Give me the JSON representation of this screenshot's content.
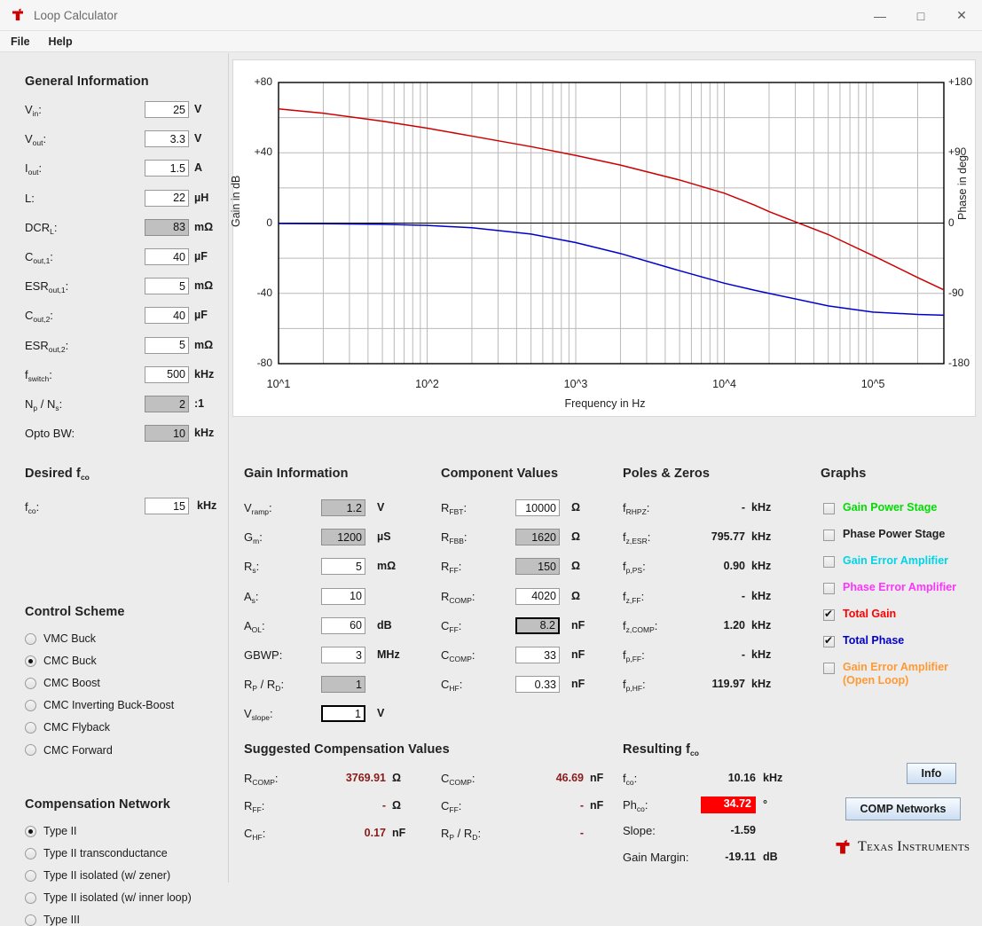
{
  "window": {
    "title": "Loop Calculator",
    "minimize": "—",
    "maximize": "□",
    "close": "✕"
  },
  "menu": {
    "file": "File",
    "help": "Help"
  },
  "general": {
    "title": "General Information",
    "rows": [
      {
        "label": "V",
        "sub": "in",
        "value": "25",
        "unit": "V",
        "disabled": false
      },
      {
        "label": "V",
        "sub": "out",
        "value": "3.3",
        "unit": "V",
        "disabled": false
      },
      {
        "label": "I",
        "sub": "out",
        "value": "1.5",
        "unit": "A",
        "disabled": false
      },
      {
        "label": "L",
        "sub": "",
        "value": "22",
        "unit": "µH",
        "disabled": false
      },
      {
        "label": "DCR",
        "sub": "L",
        "value": "83",
        "unit": "mΩ",
        "disabled": true
      },
      {
        "label": "C",
        "sub": "out,1",
        "value": "40",
        "unit": "µF",
        "disabled": false
      },
      {
        "label": "ESR",
        "sub": "out,1",
        "value": "5",
        "unit": "mΩ",
        "disabled": false
      },
      {
        "label": "C",
        "sub": "out,2",
        "value": "40",
        "unit": "µF",
        "disabled": false
      },
      {
        "label": "ESR",
        "sub": "out,2",
        "value": "5",
        "unit": "mΩ",
        "disabled": false
      },
      {
        "label": "f",
        "sub": "switch",
        "value": "500",
        "unit": "kHz",
        "disabled": false
      },
      {
        "label": "N",
        "sub": "p",
        "label2": " / N",
        "sub2": "s",
        "value": "2",
        "unit": ":1",
        "disabled": true
      },
      {
        "label": "Opto BW",
        "sub": "",
        "value": "10",
        "unit": "kHz",
        "disabled": true
      }
    ]
  },
  "desired_fco": {
    "title": "Desired f",
    "title_sub": "co",
    "label": "f",
    "label_sub": "co",
    "value": "15",
    "unit": "kHz"
  },
  "control_scheme": {
    "title": "Control Scheme",
    "options": [
      {
        "label": "VMC Buck",
        "selected": false
      },
      {
        "label": "CMC Buck",
        "selected": true
      },
      {
        "label": "CMC Boost",
        "selected": false
      },
      {
        "label": "CMC Inverting Buck-Boost",
        "selected": false
      },
      {
        "label": "CMC Flyback",
        "selected": false
      },
      {
        "label": "CMC Forward",
        "selected": false
      }
    ]
  },
  "compensation_network": {
    "title": "Compensation Network",
    "options": [
      {
        "label": "Type II",
        "selected": true
      },
      {
        "label": "Type II transconductance",
        "selected": false
      },
      {
        "label": "Type II isolated (w/ zener)",
        "selected": false
      },
      {
        "label": "Type II isolated (w/ inner loop)",
        "selected": false
      },
      {
        "label": "Type III",
        "selected": false
      }
    ]
  },
  "gain_information": {
    "title": "Gain Information",
    "rows": [
      {
        "label": "V",
        "sub": "ramp",
        "value": "1.2",
        "unit": "V",
        "disabled": true,
        "focus": false
      },
      {
        "label": "G",
        "sub": "m",
        "value": "1200",
        "unit": "µS",
        "disabled": true,
        "focus": false
      },
      {
        "label": "R",
        "sub": "s",
        "value": "5",
        "unit": "mΩ",
        "disabled": false,
        "focus": false
      },
      {
        "label": "A",
        "sub": "s",
        "value": "10",
        "unit": "",
        "disabled": false,
        "focus": false
      },
      {
        "label": "A",
        "sub": "OL",
        "value": "60",
        "unit": "dB",
        "disabled": false,
        "focus": false
      },
      {
        "label": "GBWP",
        "sub": "",
        "value": "3",
        "unit": "MHz",
        "disabled": false,
        "focus": false
      },
      {
        "label": "R",
        "sub": "P",
        "label2": " / R",
        "sub2": "D",
        "value": "1",
        "unit": "",
        "disabled": true,
        "focus": false
      },
      {
        "label": "V",
        "sub": "slope",
        "value": "1",
        "unit": "V",
        "disabled": false,
        "focus": true
      }
    ]
  },
  "component_values": {
    "title": "Component Values",
    "rows": [
      {
        "label": "R",
        "sub": "FBT",
        "value": "10000",
        "unit": "Ω",
        "disabled": false,
        "focus": false
      },
      {
        "label": "R",
        "sub": "FBB",
        "value": "1620",
        "unit": "Ω",
        "disabled": true,
        "focus": false
      },
      {
        "label": "R",
        "sub": "FF",
        "value": "150",
        "unit": "Ω",
        "disabled": true,
        "focus": false
      },
      {
        "label": "R",
        "sub": "COMP",
        "value": "4020",
        "unit": "Ω",
        "disabled": false,
        "focus": false
      },
      {
        "label": "C",
        "sub": "FF",
        "value": "8.2",
        "unit": "nF",
        "disabled": true,
        "focus": true
      },
      {
        "label": "C",
        "sub": "COMP",
        "value": "33",
        "unit": "nF",
        "disabled": false,
        "focus": false
      },
      {
        "label": "C",
        "sub": "HF",
        "value": "0.33",
        "unit": "nF",
        "disabled": false,
        "focus": false
      }
    ]
  },
  "poles_zeros": {
    "title": "Poles & Zeros",
    "rows": [
      {
        "label": "f",
        "sub": "RHPZ",
        "value": "-",
        "unit": "kHz"
      },
      {
        "label": "f",
        "sub": "z,ESR",
        "value": "795.77",
        "unit": "kHz"
      },
      {
        "label": "f",
        "sub": "p,PS",
        "value": "0.90",
        "unit": "kHz"
      },
      {
        "label": "f",
        "sub": "z,FF",
        "value": "-",
        "unit": "kHz"
      },
      {
        "label": "f",
        "sub": "z,COMP",
        "value": "1.20",
        "unit": "kHz"
      },
      {
        "label": "f",
        "sub": "p,FF",
        "value": "-",
        "unit": "kHz"
      },
      {
        "label": "f",
        "sub": "p,HF",
        "value": "119.97",
        "unit": "kHz"
      }
    ]
  },
  "graphs": {
    "title": "Graphs",
    "items": [
      {
        "label": "Gain Power Stage",
        "color": "#00dd00",
        "checked": false
      },
      {
        "label": "Phase Power Stage",
        "color": "#222222",
        "checked": false
      },
      {
        "label": "Gain Error Amplifier",
        "color": "#00d5e8",
        "checked": false
      },
      {
        "label": "Phase Error Amplifier",
        "color": "#ff33ff",
        "checked": false
      },
      {
        "label": "Total Gain",
        "color": "#ff0000",
        "checked": true
      },
      {
        "label": "Total Phase",
        "color": "#0000cc",
        "checked": true
      },
      {
        "label": "Gain Error Amplifier\n(Open Loop)",
        "color": "#ff9933",
        "checked": false
      }
    ]
  },
  "suggested": {
    "title": "Suggested Compensation Values",
    "left": [
      {
        "label": "R",
        "sub": "COMP",
        "value": "3769.91",
        "unit": "Ω"
      },
      {
        "label": "R",
        "sub": "FF",
        "value": "-",
        "unit": "Ω"
      },
      {
        "label": "C",
        "sub": "HF",
        "value": "0.17",
        "unit": "nF"
      }
    ],
    "right": [
      {
        "label": "C",
        "sub": "COMP",
        "value": "46.69",
        "unit": "nF"
      },
      {
        "label": "C",
        "sub": "FF",
        "value": "-",
        "unit": "nF"
      },
      {
        "label": "R",
        "sub": "P",
        "label2": " / R",
        "sub2": "D",
        "value": "-",
        "unit": ""
      }
    ]
  },
  "resulting": {
    "title": "Resulting f",
    "title_sub": "co",
    "rows": [
      {
        "label": "f",
        "sub": "co",
        "value": "10.16",
        "unit": "kHz",
        "highlight": false
      },
      {
        "label": "Ph",
        "sub": "co",
        "value": "34.72",
        "unit": "°",
        "highlight": true
      },
      {
        "label": "Slope",
        "sub": "",
        "value": "-1.59",
        "unit": "",
        "highlight": false
      },
      {
        "label": "Gain Margin",
        "sub": "",
        "value": "-19.11",
        "unit": "dB",
        "highlight": false
      }
    ],
    "highlight_color": "#ff0000"
  },
  "buttons": {
    "info": "Info",
    "comp_networks": "COMP Networks"
  },
  "branding": {
    "text": "Texas Instruments"
  },
  "chart_data": {
    "type": "line",
    "title": "",
    "xlabel": "Frequency in Hz",
    "ylabel": "Gain in dB",
    "ylabel_right": "Phase in deg",
    "xscale": "log",
    "xlim": [
      10,
      300000
    ],
    "ylim": [
      -80,
      80
    ],
    "ylim_right": [
      -180,
      180
    ],
    "grid": true,
    "legend_position": "external-right-panel",
    "xticks": [
      "10^1",
      "10^2",
      "10^3",
      "10^4",
      "10^5"
    ],
    "xtick_values": [
      10,
      100,
      1000,
      10000,
      100000
    ],
    "yticks_left": [
      "+80",
      "+40",
      "0",
      "-40",
      "-80"
    ],
    "ytick_values_left": [
      80,
      40,
      0,
      -40,
      -80
    ],
    "yticks_right": [
      "+180",
      "+90",
      "0",
      "-90",
      "-180"
    ],
    "ytick_values_right": [
      180,
      90,
      0,
      -90,
      -180
    ],
    "series": [
      {
        "name": "Total Gain",
        "color": "#cc0000",
        "axis": "left",
        "units": "dB",
        "x": [
          10,
          20,
          50,
          100,
          200,
          500,
          1000,
          2000,
          5000,
          10000,
          16000,
          20000,
          50000,
          100000,
          200000,
          300000
        ],
        "y": [
          65,
          62.5,
          58,
          54,
          49.5,
          43.5,
          38.5,
          33,
          24.5,
          17,
          10.2,
          6.5,
          -6.5,
          -18.5,
          -31,
          -38
        ]
      },
      {
        "name": "Total Phase",
        "color": "#0000cc",
        "axis": "right",
        "units": "deg",
        "x": [
          10,
          20,
          50,
          100,
          200,
          500,
          1000,
          2000,
          5000,
          10000,
          16000,
          20000,
          50000,
          100000,
          200000,
          300000
        ],
        "y": [
          -0.5,
          -0.8,
          -1.6,
          -3,
          -6,
          -14,
          -25,
          -39,
          -61,
          -77,
          -86,
          -90,
          -106,
          -114,
          -117,
          -118
        ]
      }
    ],
    "annotations": {
      "crossover_frequency_khz": 10.16,
      "phase_margin_deg": 34.72,
      "gain_margin_db": -19.11,
      "slope": -1.59
    }
  }
}
